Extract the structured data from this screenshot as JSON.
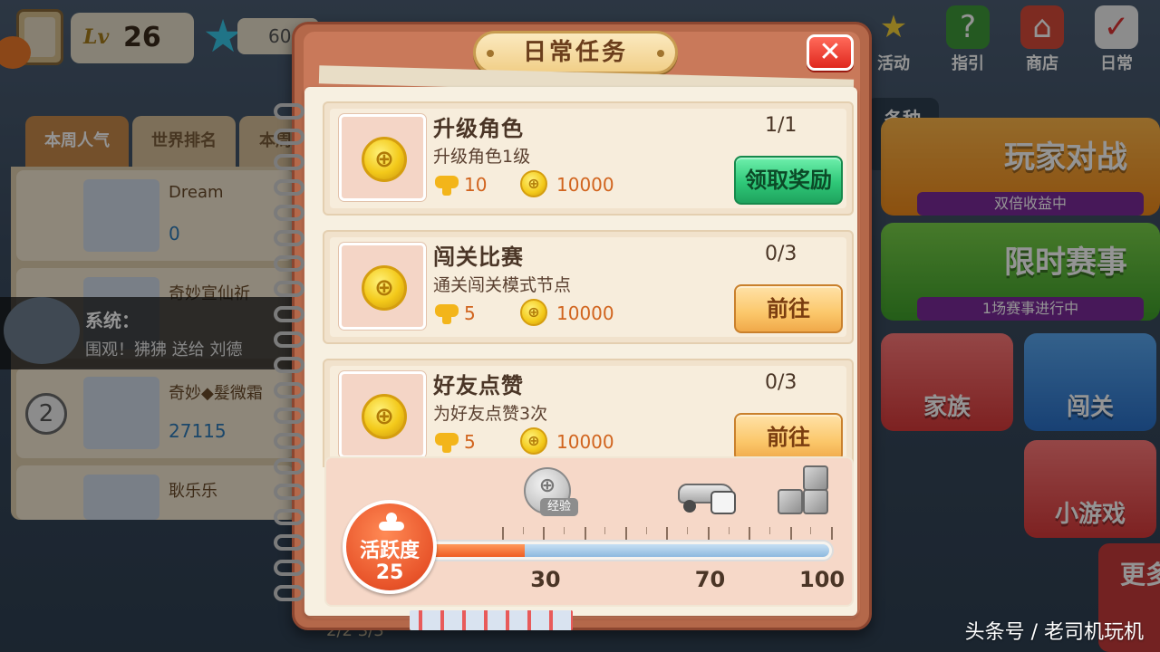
{
  "background": {
    "level_label": "Lv",
    "level_value": "26",
    "currency_value": "60",
    "tabs": [
      "本周人气",
      "世界排名",
      "本周"
    ],
    "rank_rows": [
      {
        "name": "Dream",
        "likes": "0",
        "rank": ""
      },
      {
        "name": "奇妙宣仙祈",
        "likes": "",
        "rank": ""
      },
      {
        "name": "奇妙◆髮微霜",
        "likes": "27115",
        "rank": "2"
      },
      {
        "name": "耿乐乐",
        "likes": "",
        "rank": ""
      }
    ],
    "system": {
      "title": "系统：",
      "text": "围观！狒狒 送给 刘德"
    },
    "top_buttons": [
      {
        "label": "活动",
        "icon": "star-icon"
      },
      {
        "label": "指引",
        "icon": "question-icon"
      },
      {
        "label": "商店",
        "icon": "shop-icon"
      },
      {
        "label": "日常",
        "icon": "calendar-check-icon"
      }
    ],
    "various_btn": "各种\n下来",
    "side_big": [
      {
        "title": "玩家对战",
        "subtitle": "双倍收益中"
      },
      {
        "title": "限时赛事",
        "subtitle": "1场赛事进行中"
      }
    ],
    "side_small": [
      "家族",
      "闯关",
      "小游戏"
    ],
    "more_btn": "更多",
    "bottom_strip": "2/2    3/3"
  },
  "dialog": {
    "title": "日常任务",
    "close_icon": "close-icon",
    "tasks": [
      {
        "title": "升级角色",
        "desc": "升级角色1级",
        "exp": "10",
        "coins": "10000",
        "progress": "1/1",
        "button": "领取奖励",
        "button_style": "green"
      },
      {
        "title": "闯关比赛",
        "desc": "通关闯关模式节点",
        "exp": "5",
        "coins": "10000",
        "progress": "0/3",
        "button": "前往",
        "button_style": "orange"
      },
      {
        "title": "好友点赞",
        "desc": "为好友点赞3次",
        "exp": "5",
        "coins": "10000",
        "progress": "0/3",
        "button": "前往",
        "button_style": "orange"
      }
    ],
    "activity": {
      "label": "活跃度",
      "value": "25",
      "current": 25,
      "max": 100,
      "milestones": [
        {
          "value": "30",
          "reward_icon": "exp-coin-icon",
          "reward_tag": "经验"
        },
        {
          "value": "70",
          "reward_icon": "car-dice-icon"
        },
        {
          "value": "100",
          "reward_icon": "puzzle-icon"
        }
      ]
    }
  },
  "watermark": "头条号 / 老司机玩机",
  "colors": {
    "accent_green": "#2fc878",
    "accent_orange": "#fbc76a",
    "frame_brown": "#b4684a",
    "activity_orange": "#e8542a"
  }
}
